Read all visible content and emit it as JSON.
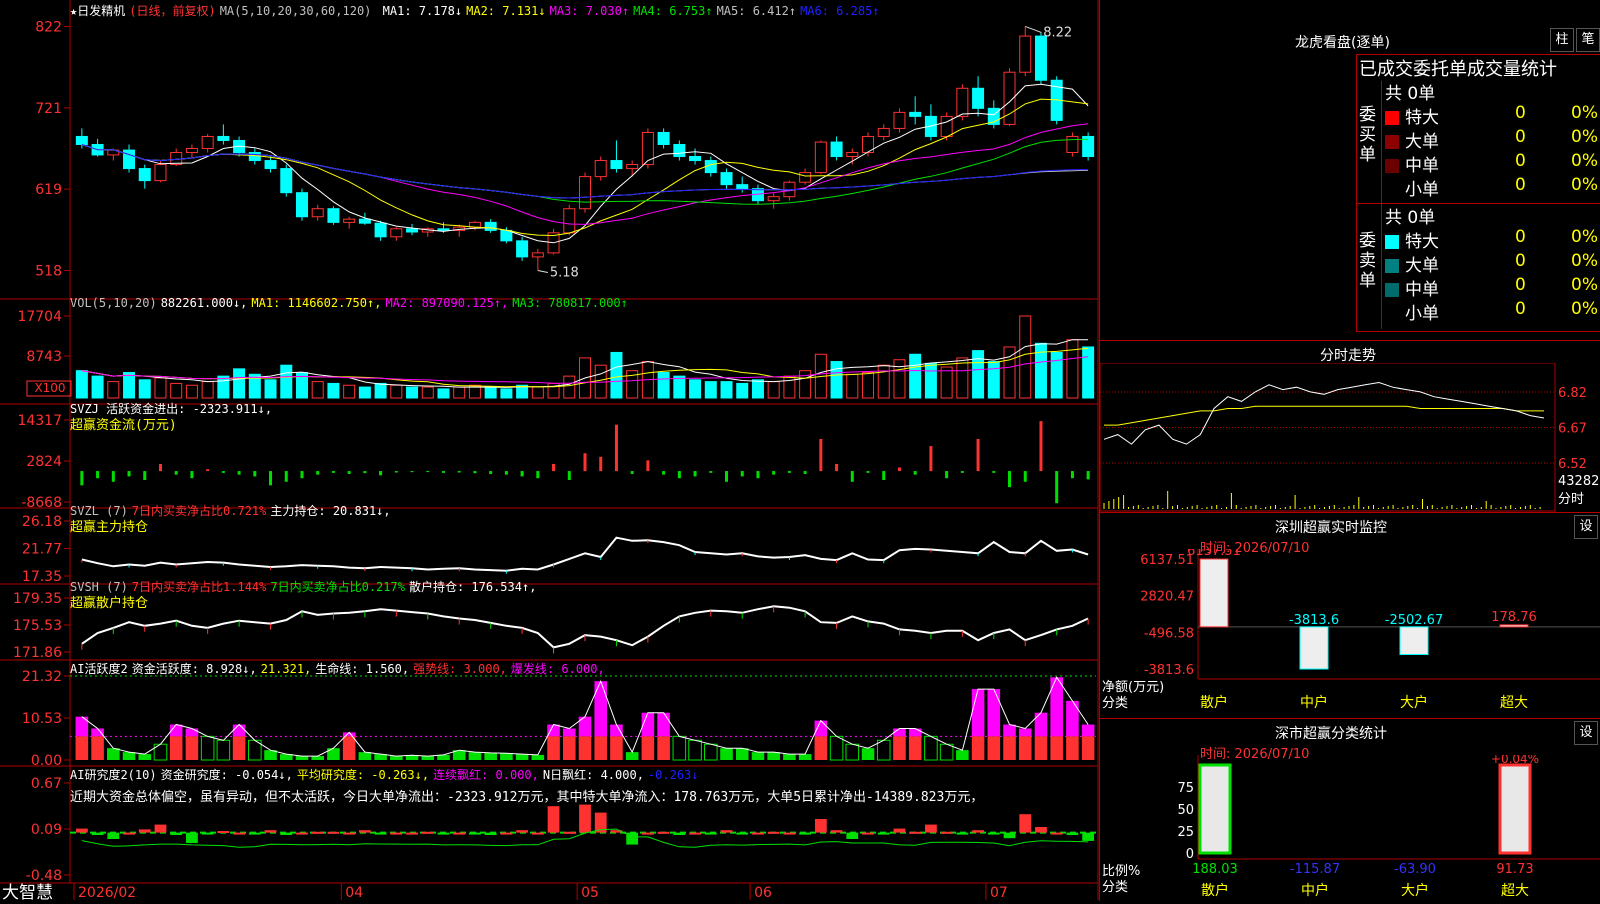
{
  "colors": {
    "up": "#ff3232",
    "down": "#00ffff",
    "grid": "#b00000",
    "ma1": "#ffffff",
    "ma2": "#ffff00",
    "ma3": "#ff00ff",
    "ma4": "#00e000",
    "ma5": "#c0c0c0",
    "ma6": "#2020ff",
    "green": "#00e000",
    "magenta": "#ff00ff",
    "yellow": "#ffff00"
  },
  "app": {
    "brand": "大智慧",
    "date_axis": [
      "2026/02",
      "04",
      "05",
      "06",
      "07"
    ]
  },
  "price_panel": {
    "title": "★日发精机",
    "mode": "(日线，前复权)",
    "ma_label": "MA(5,10,20,30,60,120)",
    "ma_values": [
      {
        "label": "MA1: 7.178↓",
        "color": "#ffffff"
      },
      {
        "label": "MA2: 7.131↓",
        "color": "#ffff00"
      },
      {
        "label": "MA3: 7.030↑",
        "color": "#ff00ff"
      },
      {
        "label": "MA4: 6.753↑",
        "color": "#00e000"
      },
      {
        "label": "MA5: 6.412↑",
        "color": "#c0c0c0"
      },
      {
        "label": "MA6: 6.285↑",
        "color": "#2020ff"
      }
    ],
    "y_ticks": [
      "822",
      "721",
      "619",
      "518"
    ],
    "high_label": "8.22",
    "low_label": "5.18"
  },
  "vol_panel": {
    "header": [
      {
        "t": "VOL(5,10,20)",
        "c": "#c0c0c0"
      },
      {
        "t": "882261.000↓,",
        "c": "#ffffff"
      },
      {
        "t": "MA1: 1146602.750↑,",
        "c": "#ffff00"
      },
      {
        "t": "MA2: 897090.125↑,",
        "c": "#ff00ff"
      },
      {
        "t": "MA3: 780817.000↑",
        "c": "#00e000"
      }
    ],
    "y_ticks": [
      "17704",
      "8743"
    ],
    "unit": "X100"
  },
  "svzj_panel": {
    "header": [
      {
        "t": "SVZJ  活跃资金进出: -2323.911↓,",
        "c": "#ffffff"
      }
    ],
    "subtitle": "超赢资金流(万元)",
    "y_ticks": [
      "14317",
      "2824",
      "-8668"
    ]
  },
  "svzl_panel": {
    "header": [
      {
        "t": "SVZL (7)",
        "c": "#c0c0c0"
      },
      {
        "t": "7日内买卖净占比0.721%",
        "c": "#ff3232"
      },
      {
        "t": "主力持仓: 20.831↓,",
        "c": "#ffffff"
      }
    ],
    "subtitle": "超赢主力持仓",
    "y_ticks": [
      "26.18",
      "21.77",
      "17.35"
    ]
  },
  "svsh_panel": {
    "header": [
      {
        "t": "SVSH (7)",
        "c": "#c0c0c0"
      },
      {
        "t": "7日内买卖净占比1.144%",
        "c": "#ff3232"
      },
      {
        "t": "7日内买卖净占比0.217%",
        "c": "#00e000"
      },
      {
        "t": "散户持仓: 176.534↑,",
        "c": "#ffffff"
      }
    ],
    "subtitle": "超赢散户持仓",
    "y_ticks": [
      "179.35",
      "175.53",
      "171.86"
    ]
  },
  "ai_active_panel": {
    "header": [
      {
        "t": "AI活跃度2",
        "c": "#ffffff"
      },
      {
        "t": "资金活跃度: 8.928↓,",
        "c": "#ffffff"
      },
      {
        "t": "21.321,",
        "c": "#ffff00"
      },
      {
        "t": "生命线: 1.560,",
        "c": "#ffffff"
      },
      {
        "t": "强势线: 3.000,",
        "c": "#ff3232"
      },
      {
        "t": "爆发线: 6.000,",
        "c": "#ff00ff"
      }
    ],
    "y_ticks": [
      "21.32",
      "10.53",
      "0.00"
    ]
  },
  "ai_research_panel": {
    "header": [
      {
        "t": "AI研究度2(10)",
        "c": "#ffffff"
      },
      {
        "t": "资金研究度: -0.054↓,",
        "c": "#ffffff"
      },
      {
        "t": "平均研究度: -0.263↓,",
        "c": "#ffff00"
      },
      {
        "t": "连续飘红: 0.000,",
        "c": "#ff00ff"
      },
      {
        "t": "N日飘红: 4.000,",
        "c": "#ffffff"
      },
      {
        "t": "-0.263↓",
        "c": "#2020ff"
      }
    ],
    "comment": "近期大资金总体偏空，虽有异动，但不太活跃，今日大单净流出：-2323.912万元，其中特大单净流入：178.763万元，大单5日累计净出-14389.823万元，",
    "y_ticks": [
      "0.67",
      "0.09",
      "-0.48"
    ]
  },
  "right": {
    "lhb_title": "龙虎看盘(逐单)",
    "btn_zhu": "柱",
    "btn_bi": "笔",
    "stats_title": "已成交委托单成交量统计",
    "buy_label": "委买单",
    "sell_label": "委卖单",
    "buy_total": "共 0单",
    "sell_total": "共 0单",
    "buy_rows": [
      {
        "name": "特大",
        "v": "0",
        "p": "0%",
        "c": "#ff0000"
      },
      {
        "name": "大单",
        "v": "0",
        "p": "0%",
        "c": "#8b0000"
      },
      {
        "name": "中单",
        "v": "0",
        "p": "0%",
        "c": "#6b0000"
      },
      {
        "name": "小单",
        "v": "0",
        "p": "0%",
        "c": ""
      }
    ],
    "sell_rows": [
      {
        "name": "特大",
        "v": "0",
        "p": "0%",
        "c": "#00ffff"
      },
      {
        "name": "大单",
        "v": "0",
        "p": "0%",
        "c": "#008080"
      },
      {
        "name": "中单",
        "v": "0",
        "p": "0%",
        "c": "#006b6b"
      },
      {
        "name": "小单",
        "v": "0",
        "p": "0%",
        "c": ""
      }
    ],
    "intraday_title": "分时走势",
    "intraday_ticks": [
      "6.82",
      "6.67",
      "6.52"
    ],
    "intraday_vol": "43282",
    "intraday_vol_unit": "分时",
    "monitor_title": "深圳超赢实时监控",
    "monitor_btn": "设",
    "monitor_time": "时间: 2026/07/10",
    "monitor_ticks": [
      "6137.51",
      "2820.47",
      "-496.58",
      "-3813.6"
    ],
    "monitor_axis_label": "净额(万元)",
    "monitor_axis_sub": "分类",
    "monitor_bars": [
      {
        "name": "散户",
        "v": 6137.51,
        "label": "6137.51"
      },
      {
        "name": "中户",
        "v": -3813.6,
        "label": "-3813.6"
      },
      {
        "name": "大户",
        "v": -2502.67,
        "label": "-2502.67"
      },
      {
        "name": "超大",
        "v": 178.76,
        "label": "178.76"
      }
    ],
    "class_title": "深市超赢分类统计",
    "class_btn": "设",
    "class_time": "时间: 2026/07/10",
    "class_ticks": [
      "75",
      "50",
      "25",
      "0"
    ],
    "class_axis_label": "比例%",
    "class_axis_sub": "分类",
    "class_top_label": "+0.04%",
    "class_bars": [
      {
        "name": "散户",
        "v": 188.03,
        "label": "188.03"
      },
      {
        "name": "中户",
        "v": -115.87,
        "label": "-115.87"
      },
      {
        "name": "大户",
        "v": -63.9,
        "label": "-63.90"
      },
      {
        "name": "超大",
        "v": 91.73,
        "label": "91.73"
      }
    ]
  },
  "chart_data": {
    "type": "candlestick",
    "candles": [
      [
        6.85,
        6.95,
        6.7,
        6.75
      ],
      [
        6.75,
        6.82,
        6.6,
        6.62
      ],
      [
        6.62,
        6.7,
        6.55,
        6.68
      ],
      [
        6.68,
        6.75,
        6.4,
        6.45
      ],
      [
        6.45,
        6.5,
        6.2,
        6.3
      ],
      [
        6.3,
        6.55,
        6.28,
        6.5
      ],
      [
        6.5,
        6.7,
        6.48,
        6.65
      ],
      [
        6.65,
        6.75,
        6.58,
        6.7
      ],
      [
        6.7,
        6.88,
        6.65,
        6.85
      ],
      [
        6.85,
        7.0,
        6.75,
        6.8
      ],
      [
        6.8,
        6.85,
        6.6,
        6.65
      ],
      [
        6.65,
        6.7,
        6.5,
        6.55
      ],
      [
        6.55,
        6.6,
        6.4,
        6.45
      ],
      [
        6.45,
        6.5,
        6.1,
        6.15
      ],
      [
        6.15,
        6.2,
        5.8,
        5.85
      ],
      [
        5.85,
        6.0,
        5.8,
        5.95
      ],
      [
        5.95,
        5.98,
        5.75,
        5.78
      ],
      [
        5.78,
        5.85,
        5.7,
        5.82
      ],
      [
        5.82,
        5.9,
        5.75,
        5.77
      ],
      [
        5.77,
        5.8,
        5.55,
        5.6
      ],
      [
        5.6,
        5.72,
        5.55,
        5.7
      ],
      [
        5.7,
        5.76,
        5.62,
        5.66
      ],
      [
        5.66,
        5.72,
        5.6,
        5.7
      ],
      [
        5.7,
        5.78,
        5.65,
        5.68
      ],
      [
        5.68,
        5.75,
        5.6,
        5.72
      ],
      [
        5.72,
        5.8,
        5.68,
        5.78
      ],
      [
        5.78,
        5.82,
        5.65,
        5.68
      ],
      [
        5.68,
        5.72,
        5.52,
        5.55
      ],
      [
        5.55,
        5.6,
        5.3,
        5.35
      ],
      [
        5.35,
        5.45,
        5.18,
        5.4
      ],
      [
        5.4,
        5.7,
        5.38,
        5.65
      ],
      [
        5.65,
        6.0,
        5.62,
        5.95
      ],
      [
        5.95,
        6.4,
        5.9,
        6.35
      ],
      [
        6.35,
        6.6,
        6.3,
        6.55
      ],
      [
        6.55,
        6.8,
        6.4,
        6.45
      ],
      [
        6.45,
        6.55,
        6.35,
        6.5
      ],
      [
        6.5,
        6.95,
        6.45,
        6.9
      ],
      [
        6.9,
        6.95,
        6.7,
        6.75
      ],
      [
        6.75,
        6.8,
        6.55,
        6.6
      ],
      [
        6.6,
        6.7,
        6.5,
        6.55
      ],
      [
        6.55,
        6.6,
        6.35,
        6.4
      ],
      [
        6.4,
        6.45,
        6.2,
        6.25
      ],
      [
        6.25,
        6.35,
        6.15,
        6.2
      ],
      [
        6.2,
        6.25,
        6.0,
        6.05
      ],
      [
        6.05,
        6.15,
        5.95,
        6.1
      ],
      [
        6.1,
        6.3,
        6.05,
        6.28
      ],
      [
        6.28,
        6.45,
        6.25,
        6.4
      ],
      [
        6.4,
        6.8,
        6.38,
        6.78
      ],
      [
        6.78,
        6.85,
        6.55,
        6.6
      ],
      [
        6.6,
        6.7,
        6.5,
        6.65
      ],
      [
        6.65,
        6.9,
        6.6,
        6.85
      ],
      [
        6.85,
        7.0,
        6.8,
        6.95
      ],
      [
        6.95,
        7.2,
        6.9,
        7.15
      ],
      [
        7.15,
        7.35,
        7.0,
        7.1
      ],
      [
        7.1,
        7.25,
        6.8,
        6.85
      ],
      [
        6.85,
        7.15,
        6.8,
        7.1
      ],
      [
        7.1,
        7.5,
        7.05,
        7.45
      ],
      [
        7.45,
        7.6,
        7.1,
        7.2
      ],
      [
        7.2,
        7.3,
        6.95,
        7.0
      ],
      [
        7.0,
        7.7,
        6.98,
        7.65
      ],
      [
        7.65,
        8.22,
        7.6,
        8.1
      ],
      [
        8.1,
        8.15,
        7.5,
        7.55
      ],
      [
        7.55,
        7.6,
        7.0,
        7.05
      ],
      [
        6.65,
        6.9,
        6.6,
        6.85
      ],
      [
        6.85,
        6.9,
        6.55,
        6.6
      ]
    ],
    "price_ylim": [
      5.0,
      8.4
    ],
    "volume": [
      15,
      12,
      9,
      14,
      10,
      11,
      8,
      7,
      9,
      12,
      16,
      13,
      10,
      18,
      14,
      9,
      8,
      7,
      6,
      8,
      7,
      6,
      6,
      5,
      6,
      7,
      6,
      5,
      7,
      6,
      8,
      12,
      22,
      18,
      25,
      15,
      20,
      14,
      12,
      10,
      9,
      9,
      8,
      10,
      9,
      12,
      15,
      24,
      20,
      13,
      14,
      18,
      21,
      24,
      19,
      17,
      22,
      26,
      20,
      28,
      45,
      30,
      25,
      32,
      28
    ],
    "volume_ylim": [
      0,
      20000
    ],
    "fund_flow": [
      -4000,
      -2000,
      -3000,
      -1500,
      -2500,
      2000,
      -1000,
      -2000,
      500,
      -500,
      -1000,
      -1500,
      -4000,
      -3000,
      -2000,
      -1000,
      -500,
      -800,
      -600,
      -1200,
      -400,
      -300,
      -200,
      -500,
      -400,
      -600,
      -800,
      -1000,
      -1500,
      -2000,
      2000,
      -2500,
      5000,
      4000,
      13000,
      -800,
      3000,
      -1000,
      -2000,
      -1500,
      -500,
      -3000,
      -1500,
      -2000,
      -1000,
      -500,
      -800,
      9000,
      2000,
      -3000,
      -500,
      -2500,
      1000,
      -1000,
      7000,
      -2000,
      -500,
      9000,
      -500,
      -4500,
      -3000,
      14000,
      -9000,
      -2000,
      -2324
    ],
    "svzl": [
      20.0,
      19.4,
      18.9,
      19.2,
      19.0,
      19.5,
      19.2,
      19.4,
      19.6,
      19.5,
      19.2,
      19.0,
      18.8,
      18.9,
      19.1,
      19.0,
      18.9,
      18.7,
      18.6,
      18.8,
      18.7,
      18.6,
      18.4,
      18.5,
      18.6,
      18.4,
      18.3,
      18.2,
      18.5,
      18.4,
      19.2,
      20.1,
      21.0,
      20.4,
      23.5,
      23.0,
      23.1,
      22.8,
      22.3,
      21.2,
      21.0,
      20.8,
      21.0,
      20.5,
      20.3,
      20.4,
      20.7,
      20.1,
      19.9,
      21.0,
      20.0,
      19.9,
      21.5,
      21.7,
      21.6,
      21.4,
      21.2,
      21.0,
      22.8,
      21.2,
      21.0,
      23.0,
      21.4,
      21.6,
      20.8
    ],
    "svsh": [
      173.0,
      174.5,
      175.2,
      176.0,
      175.5,
      175.8,
      176.2,
      175.5,
      175.2,
      175.8,
      176.2,
      176.0,
      175.8,
      176.3,
      177.5,
      177.0,
      177.2,
      177.3,
      177.5,
      177.8,
      177.6,
      177.4,
      177.2,
      176.8,
      176.5,
      176.3,
      175.9,
      175.5,
      175.2,
      174.5,
      172.5,
      173.0,
      174.2,
      174.0,
      173.5,
      172.8,
      174.0,
      175.5,
      176.8,
      177.3,
      177.6,
      177.5,
      177.3,
      177.8,
      178.2,
      178.0,
      177.5,
      176.0,
      175.9,
      176.8,
      176.1,
      175.8,
      175.0,
      174.8,
      174.5,
      174.8,
      174.8,
      173.5,
      174.5,
      175.0,
      173.5,
      174.2,
      175.0,
      175.5,
      176.5
    ],
    "ai_active": [
      11,
      8,
      3,
      2,
      1.5,
      4,
      9,
      8,
      6,
      5,
      9,
      5,
      2.5,
      1.5,
      1,
      1,
      3,
      7,
      2,
      1.5,
      1,
      1.2,
      1,
      1.3,
      2.5,
      2,
      1.8,
      1.7,
      1.5,
      1.3,
      9,
      8,
      11,
      20,
      9,
      2,
      12,
      12,
      6,
      5,
      4,
      3,
      3,
      2,
      2,
      1.5,
      1.5,
      10,
      6,
      4,
      3,
      5,
      8,
      8,
      6,
      4,
      2.5,
      18,
      18,
      9,
      8,
      12,
      21,
      15,
      9
    ],
    "ai_research": [
      0.1,
      0.02,
      -0.03,
      0.05,
      0.09,
      0.15,
      0.02,
      -0.08,
      0.03,
      0.07,
      0.05,
      0.04,
      0.08,
      0.02,
      0.05,
      0.06,
      0.06,
      0.05,
      0.08,
      0.04,
      0.05,
      0.05,
      0.06,
      0.03,
      0.05,
      0.04,
      0.02,
      0.05,
      0.08,
      0.05,
      0.38,
      0.06,
      0.4,
      0.3,
      0.08,
      -0.1,
      0.05,
      0.06,
      0.02,
      0.05,
      0.03,
      0.08,
      0.04,
      0.05,
      0.06,
      0.05,
      0.03,
      0.22,
      0.08,
      -0.03,
      0.05,
      0.03,
      0.1,
      0.06,
      0.15,
      0.06,
      0.03,
      0.08,
      0.03,
      -0.02,
      0.28,
      0.12,
      0.05,
      0.02,
      -0.054
    ],
    "intraday": [
      6.62,
      6.64,
      6.6,
      6.66,
      6.68,
      6.62,
      6.6,
      6.64,
      6.75,
      6.8,
      6.78,
      6.82,
      6.85,
      6.83,
      6.84,
      6.82,
      6.81,
      6.83,
      6.84,
      6.85,
      6.86,
      6.84,
      6.83,
      6.82,
      6.8,
      6.79,
      6.78,
      6.77,
      6.76,
      6.75,
      6.74,
      6.72,
      6.71
    ],
    "intraday_avg": [
      6.68,
      6.68,
      6.69,
      6.7,
      6.71,
      6.72,
      6.73,
      6.74,
      6.74,
      6.75,
      6.75,
      6.76,
      6.76,
      6.76,
      6.76,
      6.76,
      6.76,
      6.76,
      6.76,
      6.76,
      6.76,
      6.76,
      6.76,
      6.75,
      6.75,
      6.75,
      6.75,
      6.75,
      6.75,
      6.75,
      6.74,
      6.74,
      6.74
    ],
    "intraday_ylim": [
      6.52,
      6.9
    ]
  }
}
